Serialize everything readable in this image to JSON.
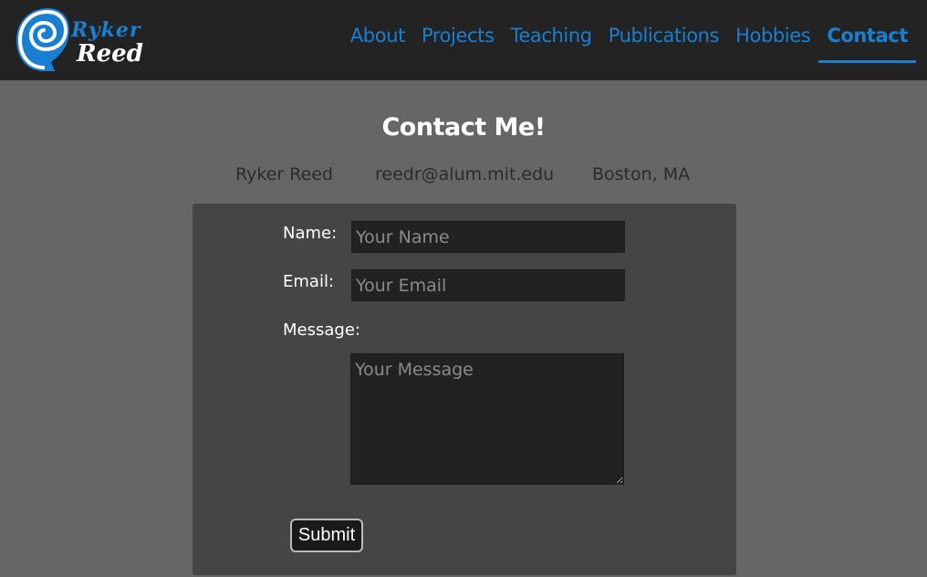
{
  "header": {
    "logo": {
      "line1": "Ryker",
      "line2": "Reed",
      "icon": "spiral-shell-icon"
    },
    "nav": [
      {
        "label": "About",
        "active": false
      },
      {
        "label": "Projects",
        "active": false
      },
      {
        "label": "Teaching",
        "active": false
      },
      {
        "label": "Publications",
        "active": false
      },
      {
        "label": "Hobbies",
        "active": false
      },
      {
        "label": "Contact",
        "active": true
      }
    ]
  },
  "contact": {
    "title": "Contact Me!",
    "name": "Ryker Reed",
    "email": "reedr@alum.mit.edu",
    "location": "Boston, MA"
  },
  "form": {
    "name_label": "Name:",
    "name_placeholder": "Your Name",
    "email_label": "Email:",
    "email_placeholder": "Your Email",
    "message_label": "Message:",
    "message_placeholder": "Your Message",
    "submit_label": "Submit"
  },
  "colors": {
    "accent": "#1a7fd0",
    "navbar_bg": "#232323",
    "page_bg": "#666666",
    "panel_bg": "#454545",
    "field_bg": "#222222"
  }
}
